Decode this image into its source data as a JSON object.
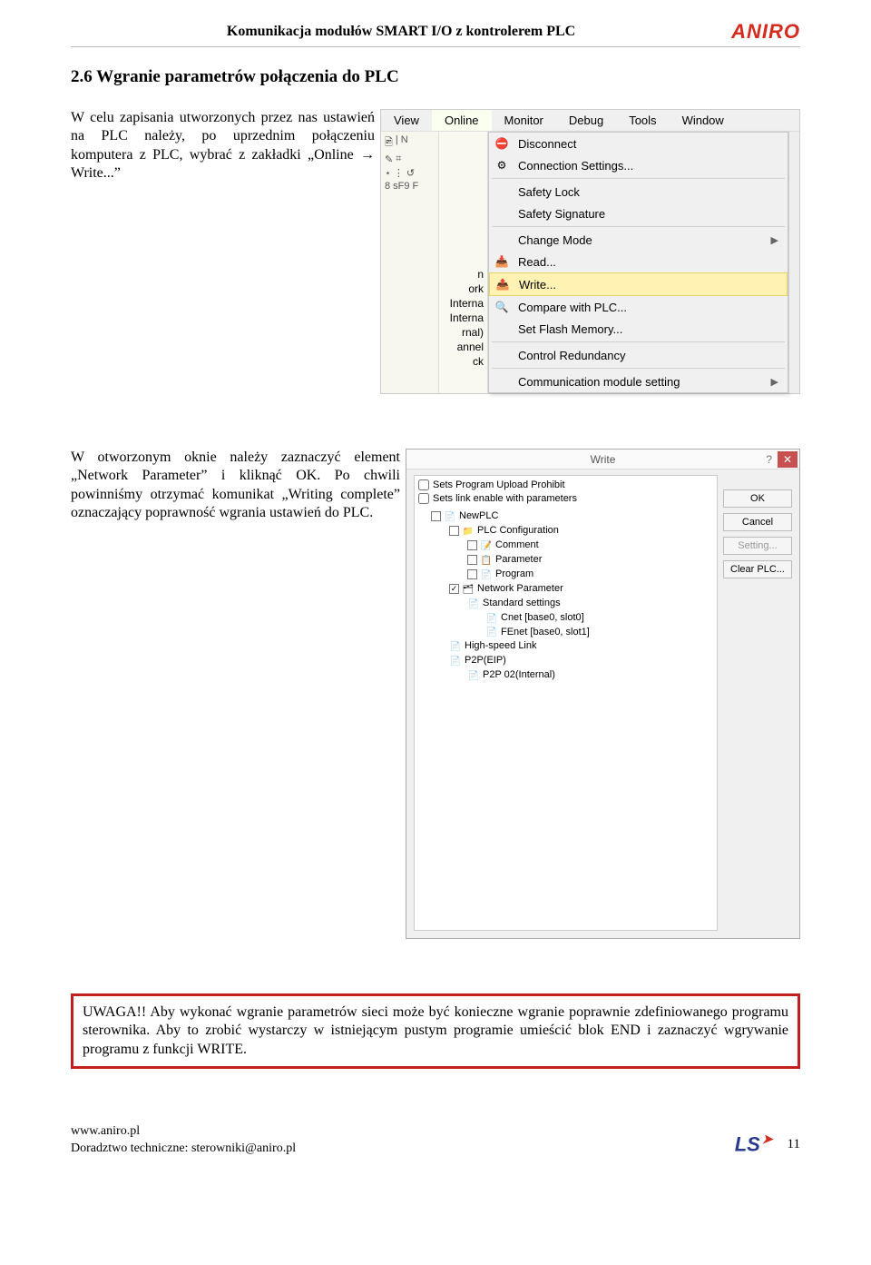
{
  "header": {
    "title": "Komunikacja modułów SMART I/O z kontrolerem PLC",
    "logo": "ANIRO"
  },
  "section": {
    "title": "2.6 Wgranie parametrów połączenia do PLC"
  },
  "p1": "W celu zapisania utworzonych przez nas ustawień na PLC należy, po uprzednim połączeniu komputera z PLC, wybrać z zakładki „Online → Write...”",
  "p2": "W otworzonym oknie należy zaznaczyć element „Network Parameter” i kliknąć OK. Po chwili powinniśmy otrzymać komunikat „Writing complete” oznaczający poprawność wgrania ustawień do PLC.",
  "warning": "UWAGA!! Aby wykonać wgranie parametrów sieci może być konieczne wgranie poprawnie zdefiniowanego programu sterownika. Aby to zrobić wystarczy w istniejącym pustym programie umieścić blok END i zaznaczyć wgrywanie programu z funkcji WRITE.",
  "menu": {
    "bar": [
      "View",
      "Online",
      "Monitor",
      "Debug",
      "Tools",
      "Window"
    ],
    "items": [
      {
        "type": "item",
        "icon": "disconnect-icon",
        "label": "Disconnect"
      },
      {
        "type": "item",
        "icon": "settings-icon",
        "label": "Connection Settings..."
      },
      {
        "type": "sep"
      },
      {
        "type": "item",
        "icon": "",
        "label": "Safety Lock"
      },
      {
        "type": "item",
        "icon": "",
        "label": "Safety Signature"
      },
      {
        "type": "sep"
      },
      {
        "type": "item",
        "icon": "",
        "label": "Change Mode",
        "arrow": true
      },
      {
        "type": "item",
        "icon": "read-icon",
        "label": "Read..."
      },
      {
        "type": "item",
        "icon": "write-icon",
        "label": "Write...",
        "highlight": true
      },
      {
        "type": "item",
        "icon": "compare-icon",
        "label": "Compare with PLC..."
      },
      {
        "type": "item",
        "icon": "",
        "label": "Set Flash Memory..."
      },
      {
        "type": "sep"
      },
      {
        "type": "item",
        "icon": "",
        "label": "Control Redundancy"
      },
      {
        "type": "sep"
      },
      {
        "type": "item",
        "icon": "",
        "label": "Communication module setting",
        "arrow": true
      }
    ],
    "left_strip": {
      "row1": [
        "🖻",
        "|",
        "N"
      ],
      "row2": [
        "✎",
        "⌗"
      ],
      "row3": [
        "⋆",
        "⋮",
        "↺"
      ],
      "row4": [
        "8",
        "sF9",
        "F"
      ]
    },
    "left_tree": [
      "n",
      "ork",
      "Interna",
      "Interna",
      "rnal)",
      "annel",
      "ck"
    ]
  },
  "write_dialog": {
    "title": "Write",
    "chk1": "Sets Program Upload Prohibit",
    "chk2": "Sets link enable with parameters",
    "tree": [
      {
        "lvl": 1,
        "chk": false,
        "icon": "📄",
        "label": "NewPLC"
      },
      {
        "lvl": 2,
        "chk": false,
        "icon": "📁",
        "label": "PLC Configuration"
      },
      {
        "lvl": 3,
        "chk": false,
        "icon": "📝",
        "label": "Comment"
      },
      {
        "lvl": 3,
        "chk": false,
        "icon": "📋",
        "label": "Parameter"
      },
      {
        "lvl": 3,
        "chk": false,
        "icon": "📄",
        "label": "Program"
      },
      {
        "lvl": 2,
        "chk": true,
        "icon": "🗂",
        "label": "Network Parameter"
      },
      {
        "lvl": 3,
        "ico_only": true,
        "icon": "📄",
        "label": "Standard settings"
      },
      {
        "lvl": 4,
        "ico_only": true,
        "icon": "📄",
        "label": "Cnet [base0, slot0]"
      },
      {
        "lvl": 4,
        "ico_only": true,
        "icon": "📄",
        "label": "FEnet [base0, slot1]"
      },
      {
        "lvl": 2,
        "ico_only": true,
        "icon": "📄",
        "label": "High-speed Link"
      },
      {
        "lvl": 2,
        "ico_only": true,
        "icon": "📄",
        "label": "P2P(EIP)"
      },
      {
        "lvl": 3,
        "ico_only": true,
        "icon": "📄",
        "label": "P2P 02(Internal)"
      }
    ],
    "buttons": {
      "ok": "OK",
      "cancel": "Cancel",
      "setting": "Setting...",
      "clear": "Clear PLC..."
    }
  },
  "footer": {
    "site": "www.aniro.pl",
    "support": "Doradztwo techniczne: sterowniki@aniro.pl",
    "ls": "LS",
    "page": "11"
  }
}
